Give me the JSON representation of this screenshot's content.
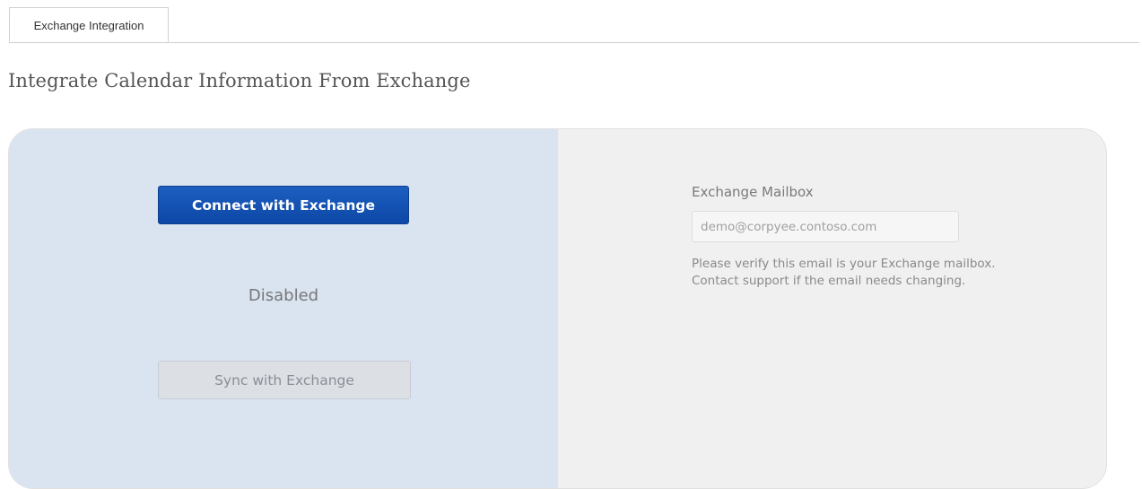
{
  "tabs": [
    {
      "label": "Exchange Integration",
      "active": true
    }
  ],
  "page": {
    "title": "Integrate Calendar Information From Exchange"
  },
  "left_panel": {
    "connect_label": "Connect with Exchange",
    "status": "Disabled",
    "sync_label": "Sync with Exchange",
    "sync_enabled": false
  },
  "right_panel": {
    "mailbox_label": "Exchange Mailbox",
    "mailbox_value": "demo@corpyee.contoso.com",
    "help_line1": "Please verify this email is your Exchange mailbox.",
    "help_line2": "Contact support if the email needs changing."
  },
  "colors": {
    "accent_blue": "#0d47a6",
    "left_panel_bg": "#dae4f1",
    "right_panel_bg": "#f0f0f0"
  }
}
